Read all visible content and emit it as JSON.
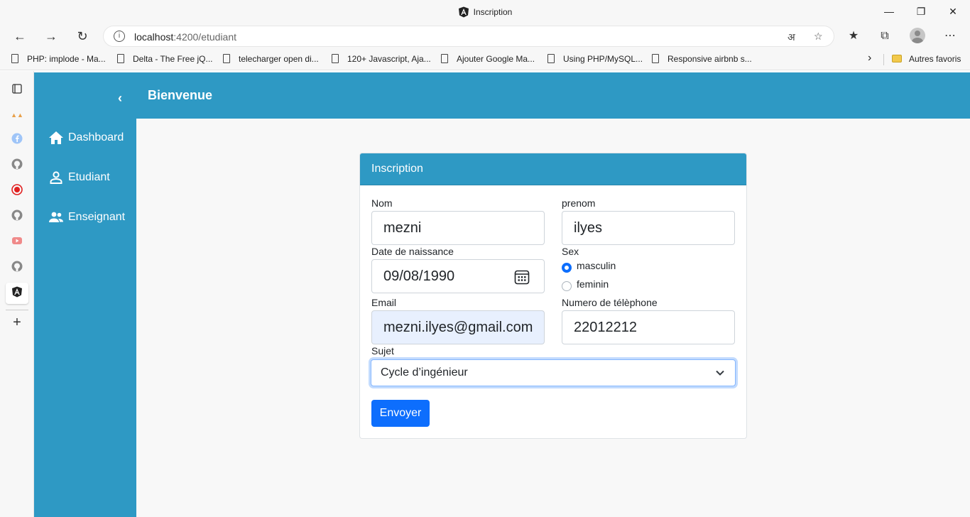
{
  "window": {
    "title": "Inscription"
  },
  "toolbar": {
    "url_host": "localhost",
    "url_path": ":4200/etudiant"
  },
  "bookmarks": [
    {
      "label": "PHP: implode - Ma..."
    },
    {
      "label": "Delta - The Free jQ..."
    },
    {
      "label": "telecharger open di..."
    },
    {
      "label": "120+ Javascript, Aja..."
    },
    {
      "label": "Ajouter Google Ma..."
    },
    {
      "label": "Using PHP/MySQL..."
    },
    {
      "label": "Responsive airbnb s..."
    }
  ],
  "bookmarks_other": "Autres favoris",
  "sidebar": {
    "items": [
      {
        "label": "Dashboard",
        "icon": "home-icon"
      },
      {
        "label": "Etudiant",
        "icon": "person-icon"
      },
      {
        "label": "Enseignant",
        "icon": "people-icon"
      }
    ]
  },
  "header": {
    "title": "Bienvenue"
  },
  "form": {
    "card_title": "Inscription",
    "nom": {
      "label": "Nom",
      "value": "mezni"
    },
    "prenom": {
      "label": "prenom",
      "value": "ilyes"
    },
    "date": {
      "label": "Date de naissance",
      "value": "09/08/1990"
    },
    "sex": {
      "label": "Sex",
      "options": [
        {
          "label": "masculin",
          "checked": true
        },
        {
          "label": "feminin",
          "checked": false
        }
      ]
    },
    "email": {
      "label": "Email",
      "value": "mezni.ilyes@gmail.com"
    },
    "telephone": {
      "label": "Numero de télèphone",
      "value": "22012212"
    },
    "sujet": {
      "label": "Sujet",
      "value": "Cycle d’ingénieur"
    },
    "submit_label": "Envoyer"
  },
  "colors": {
    "primary": "#2e99c4",
    "button": "#0d6efd",
    "autofill": "#e8f0fe"
  }
}
